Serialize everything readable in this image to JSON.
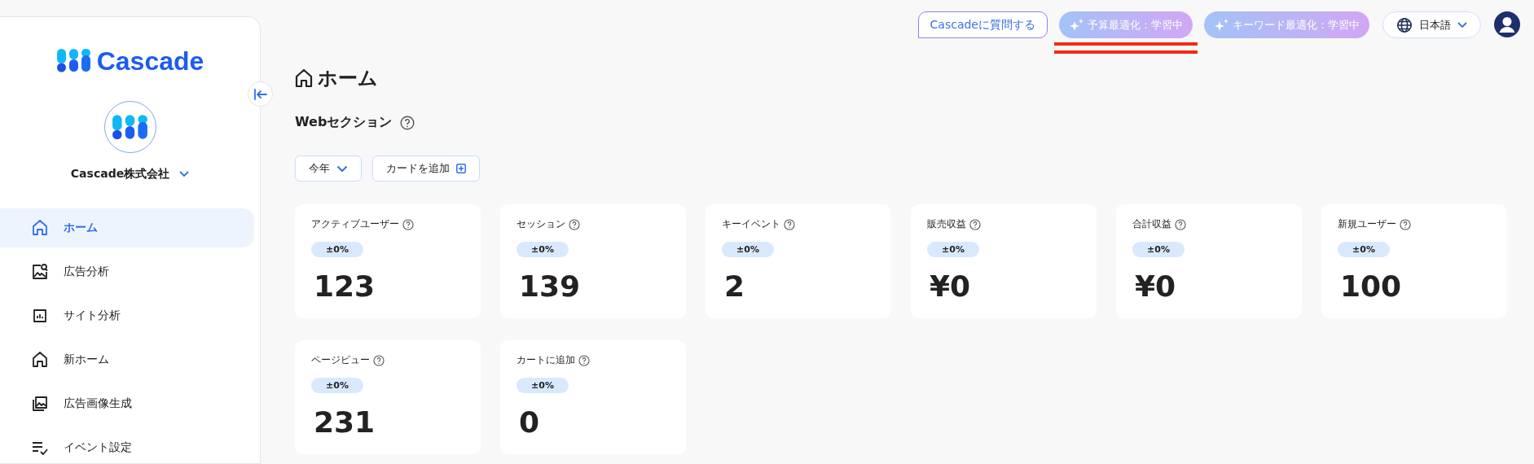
{
  "sidebar": {
    "logo": "Cascade",
    "company": "Cascade株式会社",
    "items": [
      {
        "label": "ホーム",
        "selected": true
      },
      {
        "label": "広告分析",
        "selected": false
      },
      {
        "label": "サイト分析",
        "selected": false
      },
      {
        "label": "新ホーム",
        "selected": false
      },
      {
        "label": "広告画像生成",
        "selected": false
      },
      {
        "label": "イベント設定",
        "selected": false
      }
    ]
  },
  "header": {
    "ask_button": "Cascadeに質問する",
    "status_pills": [
      {
        "label": "予算最適化：学習中",
        "highlighted": true
      },
      {
        "label": "キーワード最適化：学習中",
        "highlighted": false
      }
    ],
    "language": "日本語"
  },
  "page": {
    "title": "ホーム",
    "section": "Webセクション",
    "period": "今年",
    "add_card": "カードを追加",
    "cards": [
      {
        "label": "アクティブユーザー",
        "change": "±0%",
        "value": "123"
      },
      {
        "label": "セッション",
        "change": "±0%",
        "value": "139"
      },
      {
        "label": "キーイベント",
        "change": "±0%",
        "value": "2"
      },
      {
        "label": "販売収益",
        "change": "±0%",
        "value": "¥0"
      },
      {
        "label": "合計収益",
        "change": "±0%",
        "value": "¥0"
      },
      {
        "label": "新規ユーザー",
        "change": "±0%",
        "value": "100"
      },
      {
        "label": "ページビュー",
        "change": "±0%",
        "value": "231"
      },
      {
        "label": "カートに追加",
        "change": "±0%",
        "value": "0"
      }
    ]
  }
}
